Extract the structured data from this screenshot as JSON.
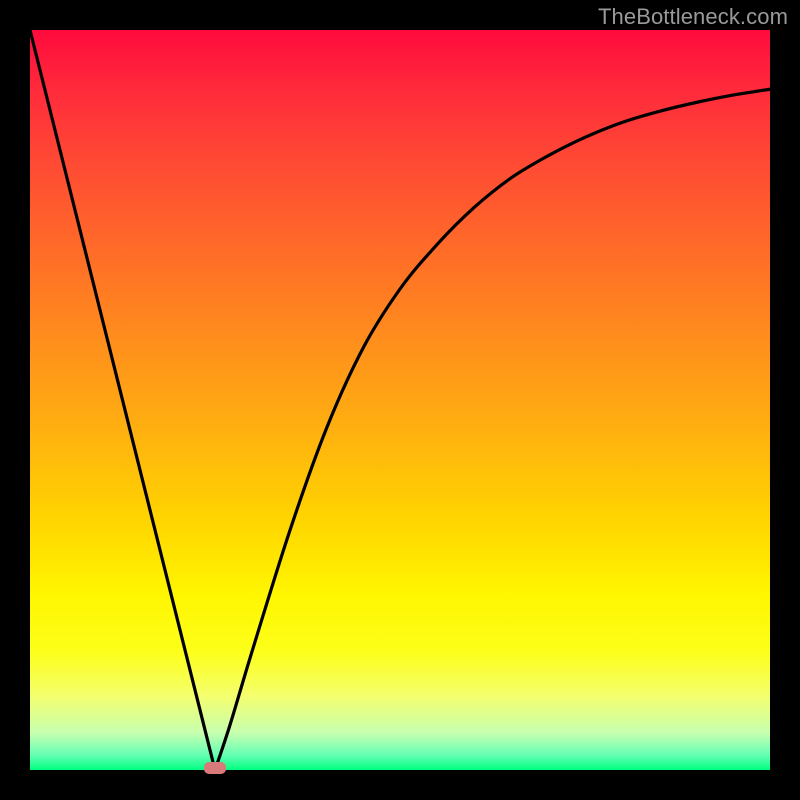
{
  "attribution": "TheBottleneck.com",
  "chart_data": {
    "type": "line",
    "title": "",
    "xlabel": "",
    "ylabel": "",
    "xlim": [
      0,
      100
    ],
    "ylim": [
      0,
      100
    ],
    "grid": false,
    "legend": false,
    "notes": "Curve is two branches meeting at a minimum near x≈25, y≈0. Background is a vertical heat gradient from red (top, high) to green (bottom, low). A small rounded marker sits at the minimum.",
    "series": [
      {
        "name": "bottleneck-curve",
        "x": [
          0,
          5,
          10,
          15,
          20,
          23,
          25,
          27,
          30,
          35,
          40,
          45,
          50,
          55,
          60,
          65,
          70,
          75,
          80,
          85,
          90,
          95,
          100
        ],
        "values": [
          100,
          80,
          60,
          40,
          20,
          8,
          0,
          6,
          16,
          32,
          46,
          57,
          65,
          71,
          76,
          80,
          83,
          85.5,
          87.5,
          89,
          90.2,
          91.2,
          92
        ]
      }
    ],
    "marker": {
      "x": 25,
      "y": 0,
      "color": "#d97a7a"
    },
    "gradient_colors": {
      "top": "#ff0b3d",
      "mid_upper": "#ff8e1c",
      "mid": "#ffd400",
      "mid_lower": "#fff500",
      "bottom": "#00ff80"
    },
    "frame_color": "#000000",
    "curve_color": "#000000"
  }
}
